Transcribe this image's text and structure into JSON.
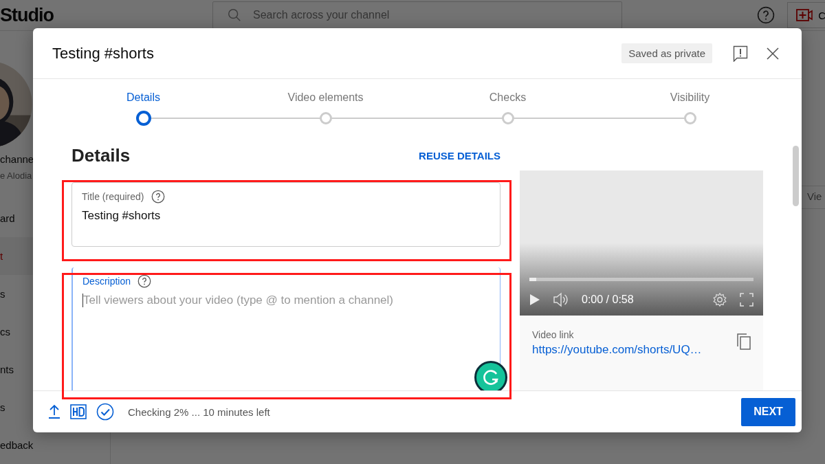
{
  "background": {
    "logo": "Studio",
    "search_placeholder": "Search across your channel",
    "create_button": "C",
    "channel_name": "channe",
    "channel_handle": "e Alodia",
    "nav_items": [
      {
        "label": "ard",
        "selected": false
      },
      {
        "label": "t",
        "selected": true
      },
      {
        "label": "s",
        "selected": false
      },
      {
        "label": "cs",
        "selected": false
      },
      {
        "label": "nts",
        "selected": false
      },
      {
        "label": "s",
        "selected": false
      },
      {
        "label": "edback",
        "selected": false
      }
    ],
    "column_label": "Vie"
  },
  "dialog": {
    "title": "Testing #shorts",
    "save_status": "Saved as private",
    "steps": [
      {
        "label": "Details",
        "selected": true
      },
      {
        "label": "Video elements",
        "selected": false
      },
      {
        "label": "Checks",
        "selected": false
      },
      {
        "label": "Visibility",
        "selected": false
      }
    ],
    "section_title": "Details",
    "reuse_button": "REUSE DETAILS",
    "title_field": {
      "label": "Title (required)",
      "value": "Testing #shorts",
      "highlighted": true,
      "focused": false
    },
    "description_field": {
      "label": "Description",
      "placeholder": "Tell viewers about your video (type @ to mention a channel)",
      "highlighted": true,
      "focused": true
    },
    "player": {
      "time": "0:00 / 0:58",
      "level": 0.03
    },
    "video_link": {
      "label": "Video link",
      "url": "https://youtube.com/shorts/UQ…"
    },
    "status": "Checking 2% ... 10 minutes left",
    "next_button": "NEXT"
  }
}
